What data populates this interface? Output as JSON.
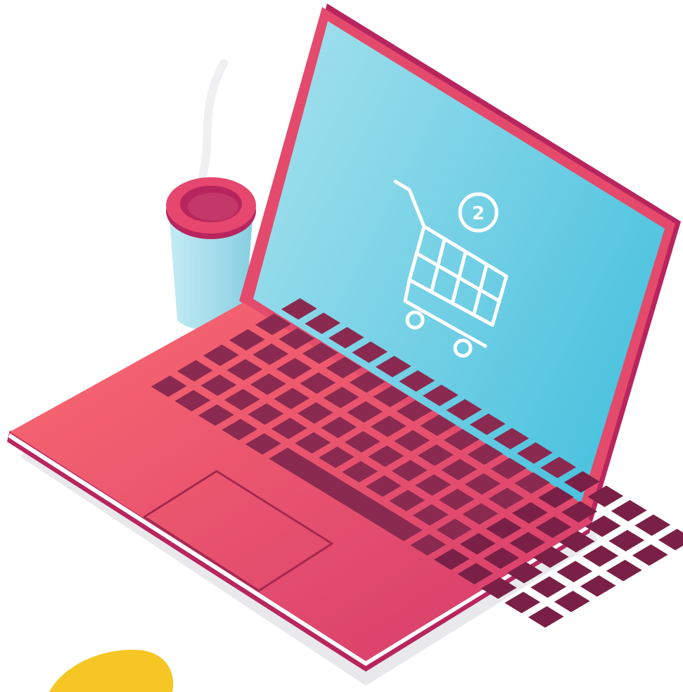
{
  "illustration": {
    "subject": "laptop-with-shopping-cart",
    "screen": {
      "icon": "shopping-cart-icon",
      "cart_badge_count": "2"
    },
    "props": {
      "coffee_cup_icon": "coffee-cup-icon",
      "steam_icon": "steam-icon",
      "blob_icon": "yellow-blob"
    }
  },
  "colors": {
    "background": "#ffffff",
    "laptop_body_light": "#fb6a70",
    "laptop_body_dark": "#d43a6c",
    "laptop_edge": "#b8255e",
    "screen_frame": "#e44a6b",
    "screen_light": "#a8e2ee",
    "screen_dark": "#4ec3df",
    "keys": "#8a2a50",
    "keys_dark": "#7a2046",
    "icon_stroke": "#ffffff",
    "cup_body": "#a9e0ec",
    "cup_lid": "#e5476e",
    "cup_lid_dark": "#b8255e",
    "yellow_blob": "#f6c624",
    "shadow": "#e9e9ec"
  }
}
